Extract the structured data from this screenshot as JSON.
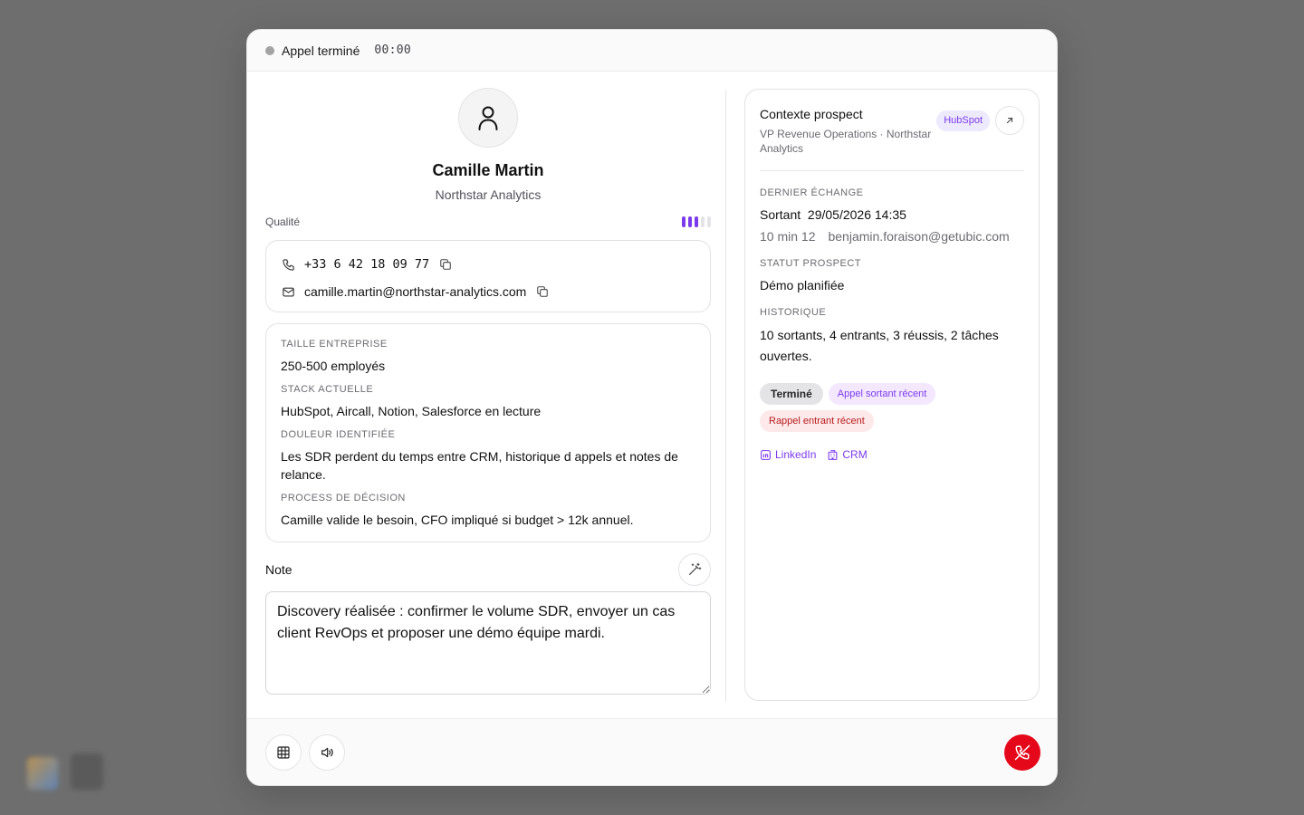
{
  "call": {
    "status": "Appel terminé",
    "timer": "00:00"
  },
  "contact": {
    "name": "Camille Martin",
    "company": "Northstar Analytics",
    "quality_label": "Qualité",
    "quality_level": 3,
    "quality_max": 5,
    "phone": "+33 6 42 18 09 77",
    "email": "camille.martin@northstar-analytics.com"
  },
  "fields": [
    {
      "label": "Taille entreprise",
      "value": "250-500 employés"
    },
    {
      "label": "Stack actuelle",
      "value": "HubSpot, Aircall, Notion, Salesforce en lecture"
    },
    {
      "label": "Douleur identifiée",
      "value": "Les SDR perdent du temps entre CRM, historique d appels et notes de relance."
    },
    {
      "label": "Process de décision",
      "value": "Camille valide le besoin, CFO impliqué si budget > 12k annuel."
    }
  ],
  "note": {
    "label": "Note",
    "value": "Discovery réalisée : confirmer le volume SDR, envoyer un cas client RevOps et proposer une démo équipe mardi."
  },
  "context": {
    "title": "Contexte prospect",
    "subtitle": "VP Revenue Operations · Northstar Analytics",
    "source_badge": "HubSpot",
    "last_exchange_label": "Dernier échange",
    "last_exchange_direction": "Sortant",
    "last_exchange_datetime": "29/05/2026 14:35",
    "last_exchange_duration": "10 min 12",
    "last_exchange_user": "benjamin.foraison@getubic.com",
    "status_label": "Statut prospect",
    "status_value": "Démo planifiée",
    "history_label": "Historique",
    "history_value": "10 sortants, 4 entrants, 3 réussis, 2 tâches ouvertes.",
    "tags": {
      "done": "Terminé",
      "outgoing": "Appel sortant récent",
      "incoming": "Rappel entrant récent"
    },
    "links": {
      "linkedin": "LinkedIn",
      "crm": "CRM"
    }
  },
  "colors": {
    "accent": "#7c3aed",
    "hangup": "#e5081a",
    "status_dot": "#a3a3a3",
    "overlay": "#6e6e6e"
  }
}
